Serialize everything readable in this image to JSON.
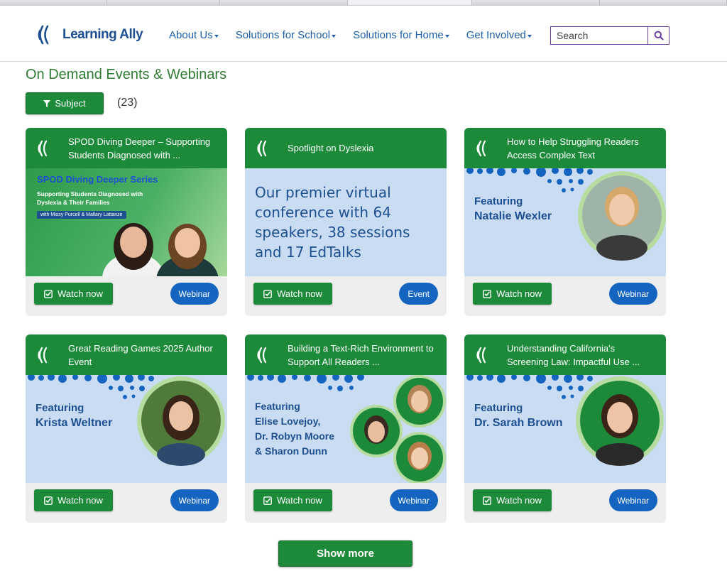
{
  "header": {
    "logo_text": "Learning Ally",
    "nav": [
      {
        "label": "About Us"
      },
      {
        "label": "Solutions for School"
      },
      {
        "label": "Solutions for Home"
      },
      {
        "label": "Get Involved"
      }
    ],
    "search": {
      "placeholder": "Search"
    }
  },
  "page": {
    "title": "On Demand Events & Webinars",
    "filter_label": "Subject",
    "count": "(23)",
    "show_more": "Show more"
  },
  "cards": [
    {
      "title": "SPOD Diving Deeper – Supporting Students Diagnosed with ...",
      "image": {
        "series": "SPOD Diving Deeper Series",
        "subtitle_line1": "Supporting Students Diagnosed with",
        "subtitle_line2": "Dyslexia & Their Families",
        "with": "with Missy Purcell & Mallary Lattanze"
      },
      "watch": "Watch now",
      "type": "Webinar"
    },
    {
      "title": "Spotlight on Dyslexia",
      "image": {
        "text": "Our premier virtual conference with 64 speakers, 38 sessions and 17 EdTalks"
      },
      "watch": "Watch now",
      "type": "Event"
    },
    {
      "title": "How to Help Struggling Readers Access Complex Text",
      "image": {
        "lead": "Featuring",
        "name": "Natalie Wexler"
      },
      "watch": "Watch now",
      "type": "Webinar"
    },
    {
      "title": "Great Reading Games 2025 Author Event",
      "image": {
        "lead": "Featuring",
        "name": "Krista Weltner"
      },
      "watch": "Watch now",
      "type": "Webinar"
    },
    {
      "title": "Building a Text-Rich Environment to Support All Readers ...",
      "image": {
        "lead": "Featuring",
        "line1": "Elise Lovejoy,",
        "line2": "Dr. Robyn Moore",
        "line3": "& Sharon Dunn"
      },
      "watch": "Watch now",
      "type": "Webinar"
    },
    {
      "title": "Understanding California's Screening Law: Impactful Use ...",
      "image": {
        "lead": "Featuring",
        "name": "Dr. Sarah Brown"
      },
      "watch": "Watch now",
      "type": "Webinar"
    }
  ],
  "colors": {
    "brand_green": "#1d8a3a",
    "brand_blue": "#1d4f91",
    "badge_blue": "#1565c0",
    "title_green": "#2e7d32",
    "image_blue": "#c9dcf2"
  }
}
